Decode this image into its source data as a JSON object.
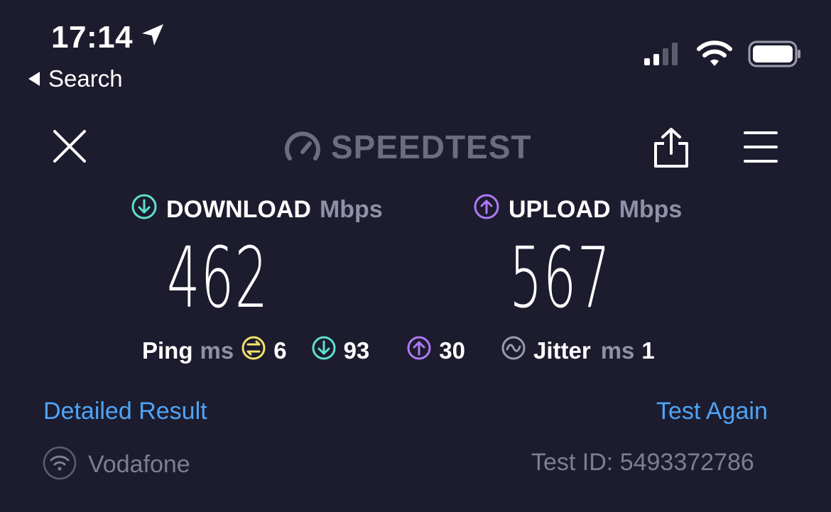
{
  "status_bar": {
    "time": "17:14",
    "back_label": "Search"
  },
  "app": {
    "brand": "SPEEDTEST"
  },
  "download": {
    "label": "DOWNLOAD",
    "unit": "Mbps",
    "value": "462",
    "color": "#5ee0d0"
  },
  "upload": {
    "label": "UPLOAD",
    "unit": "Mbps",
    "value": "567",
    "color": "#b07af5"
  },
  "ping": {
    "label": "Ping",
    "unit": "ms",
    "idle": "6",
    "download": "93",
    "upload": "30",
    "idle_color": "#f2e26a"
  },
  "jitter": {
    "label": "Jitter",
    "unit": "ms",
    "value": "1"
  },
  "links": {
    "detailed": "Detailed Result",
    "again": "Test Again"
  },
  "footer": {
    "provider": "Vodafone",
    "test_id": "Test ID: 5493372786"
  }
}
